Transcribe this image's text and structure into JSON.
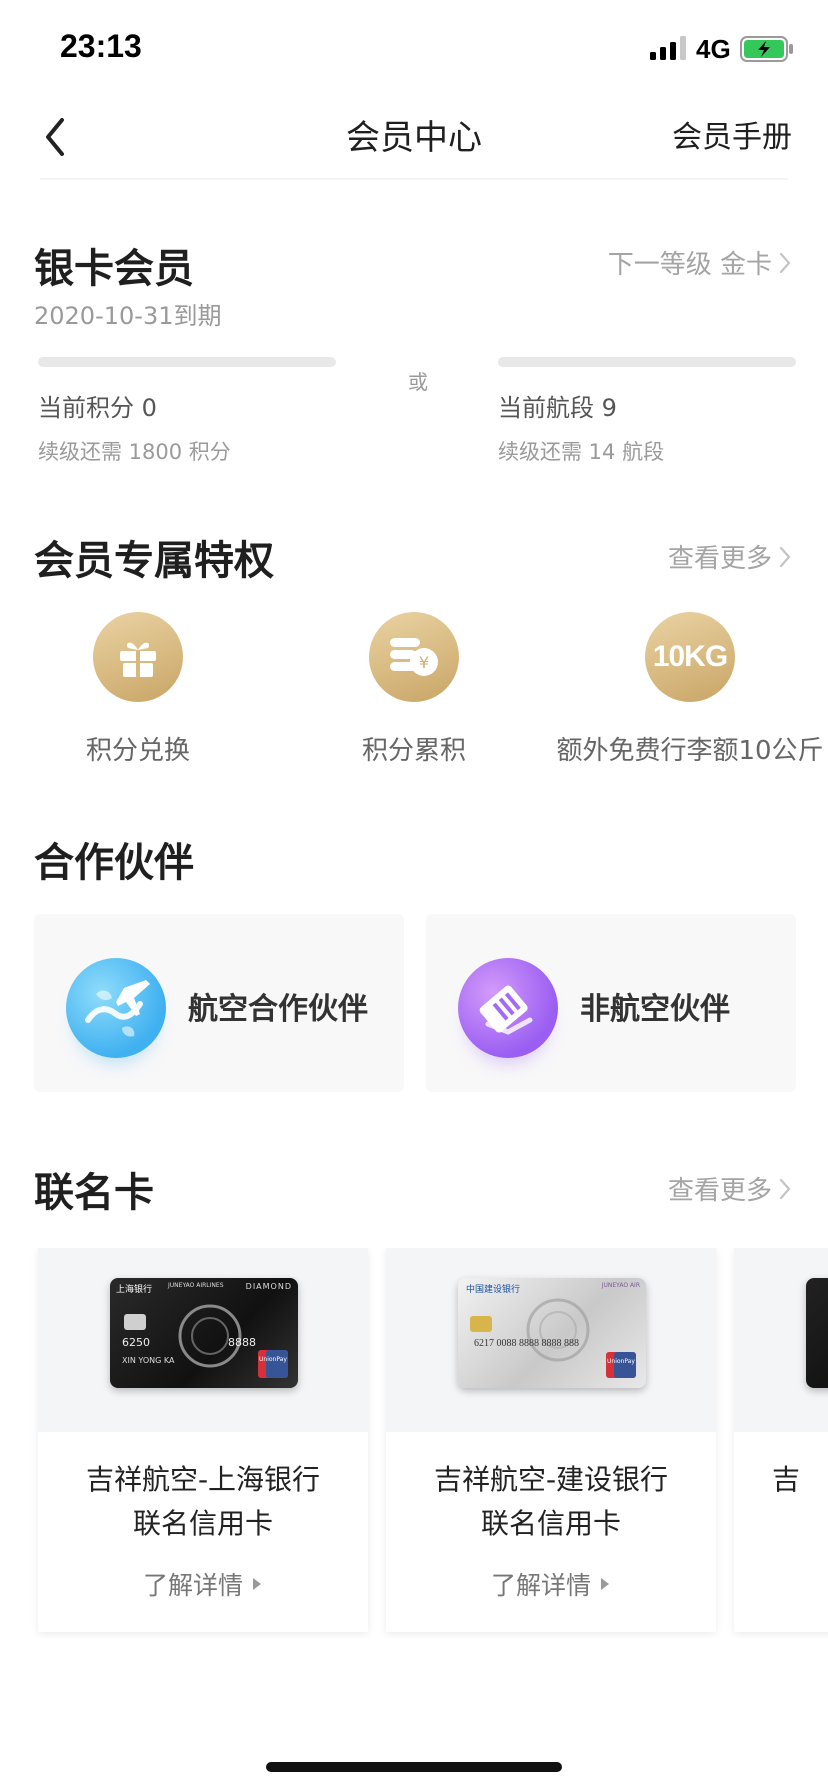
{
  "status_bar": {
    "time": "23:13",
    "network": "4G",
    "icons": [
      "signal-icon",
      "battery-charging-icon"
    ]
  },
  "nav": {
    "title": "会员中心",
    "right_action": "会员手册",
    "back_icon": "chevron-left-icon"
  },
  "level": {
    "title": "银卡会员",
    "expiry": "2020-10-31到期",
    "next_level": "下一等级 金卡",
    "or_label": "或",
    "points": {
      "current": "当前积分 0",
      "needed": "续级还需 1800 积分",
      "progress": 0
    },
    "segments": {
      "current": "当前航段 9",
      "needed": "续级还需 14 航段",
      "progress": 0
    }
  },
  "privileges": {
    "title": "会员专属特权",
    "more": "查看更多",
    "items": [
      {
        "label": "积分兑换",
        "icon": "gift-icon"
      },
      {
        "label": "积分累积",
        "icon": "coins-icon"
      },
      {
        "label": "额外免费行李额10公斤",
        "icon": "ten-kg-icon",
        "icon_text": "10KG"
      }
    ]
  },
  "partners": {
    "title": "合作伙伴",
    "items": [
      {
        "label": "航空合作伙伴",
        "icon": "airplane-globe-icon"
      },
      {
        "label": "非航空伙伴",
        "icon": "handshake-card-icon"
      }
    ]
  },
  "cobrand": {
    "title": "联名卡",
    "more": "查看更多",
    "detail_label": "了解详情",
    "cards": [
      {
        "line1": "吉祥航空-上海银行",
        "line2": "联名信用卡",
        "bank": "上海银行",
        "airline": "JUNEYAO AIRLINES",
        "tier": "DIAMOND",
        "number": "6250",
        "holder": "XIN YONG KA",
        "digits": "8888",
        "union": "UnionPay"
      },
      {
        "line1": "吉祥航空-建设银行",
        "line2": "联名信用卡",
        "bank": "中国建设银行",
        "airline": "JUNEYAO AIR",
        "number": "6217 0088 8888 8888 888",
        "union": "UnionPay"
      },
      {
        "line1": "吉",
        "line2": ""
      }
    ]
  },
  "colors": {
    "gold_light": "#ead3a3",
    "gold_dark": "#c9a566",
    "sky_blue": "#3fb0f0",
    "purple": "#9a5ef2",
    "muted_text": "#a4a4a4"
  }
}
